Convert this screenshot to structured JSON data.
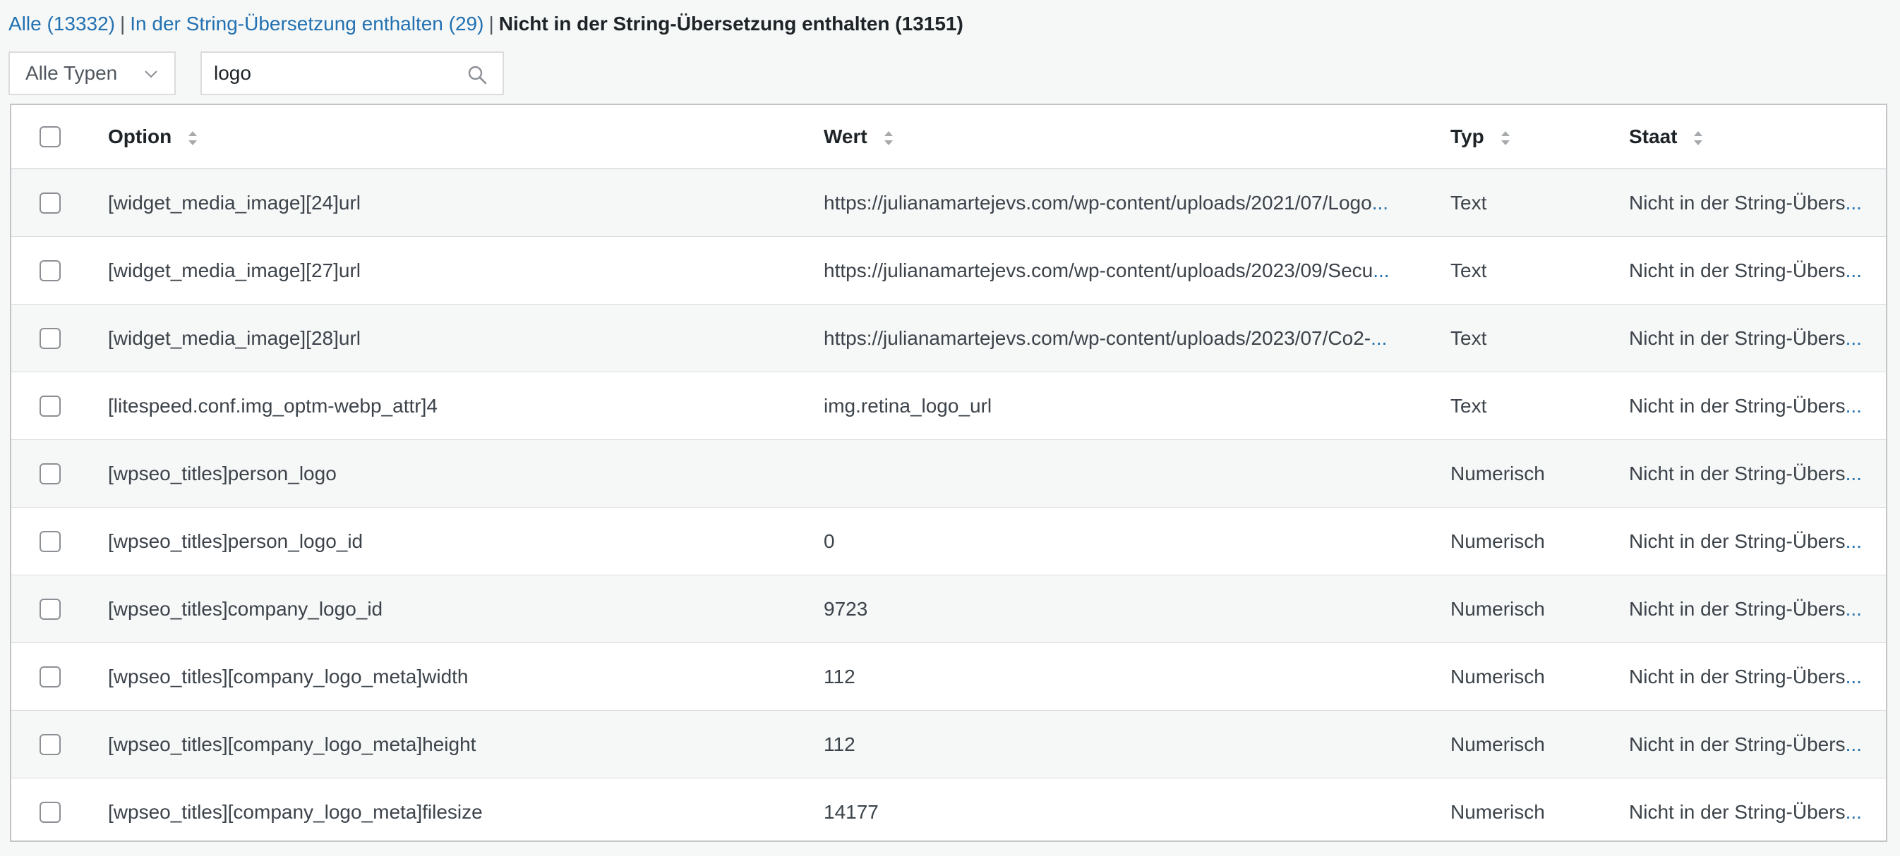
{
  "filters": {
    "all": "Alle (13332)",
    "in": "In der String-Übersetzung enthalten (29)",
    "not_in": "Nicht in der String-Übersetzung enthalten (13151)",
    "separator": "|"
  },
  "type_select": {
    "value": "Alle Typen",
    "icon": "chevron-down-icon"
  },
  "search": {
    "value": "logo",
    "icon": "search-icon"
  },
  "table": {
    "columns": [
      "Option",
      "Wert",
      "Typ",
      "Staat"
    ],
    "rows": [
      {
        "option": "[widget_media_image][24]url",
        "value": "https://julianamartejevs.com/wp-content/uploads/2021/07/Logo",
        "type": "Text",
        "status": "Nicht in der String-Übers"
      },
      {
        "option": "[widget_media_image][27]url",
        "value": "https://julianamartejevs.com/wp-content/uploads/2023/09/Secu",
        "type": "Text",
        "status": "Nicht in der String-Übers"
      },
      {
        "option": "[widget_media_image][28]url",
        "value": "https://julianamartejevs.com/wp-content/uploads/2023/07/Co2-",
        "type": "Text",
        "status": "Nicht in der String-Übers"
      },
      {
        "option": "[litespeed.conf.img_optm-webp_attr]4",
        "value": "img.retina_logo_url",
        "type": "Text",
        "status": "Nicht in der String-Übers"
      },
      {
        "option": "[wpseo_titles]person_logo",
        "value": "",
        "type": "Numerisch",
        "status": "Nicht in der String-Übers"
      },
      {
        "option": "[wpseo_titles]person_logo_id",
        "value": "0",
        "type": "Numerisch",
        "status": "Nicht in der String-Übers"
      },
      {
        "option": "[wpseo_titles]company_logo_id",
        "value": "9723",
        "type": "Numerisch",
        "status": "Nicht in der String-Übers"
      },
      {
        "option": "[wpseo_titles][company_logo_meta]width",
        "value": "112",
        "type": "Numerisch",
        "status": "Nicht in der String-Übers"
      },
      {
        "option": "[wpseo_titles][company_logo_meta]height",
        "value": "112",
        "type": "Numerisch",
        "status": "Nicht in der String-Übers"
      },
      {
        "option": "[wpseo_titles][company_logo_meta]filesize",
        "value": "14177",
        "type": "Numerisch",
        "status": "Nicht in der String-Übers"
      }
    ],
    "ellipsis": "...",
    "truncated_values": [
      true,
      true,
      true,
      false,
      false,
      false,
      false,
      false,
      false,
      false
    ],
    "sort_icon": "sort-arrows-icon"
  },
  "colors": {
    "link": "#2271b1",
    "text": "#1d2327",
    "border": "#c3c4c7",
    "stripe": "#f6f7f7"
  }
}
